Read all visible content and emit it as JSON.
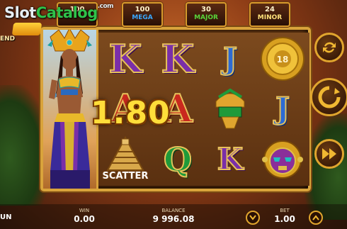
{
  "watermark": {
    "part1": "Slot",
    "part2": "Catalog",
    "part3": ".com"
  },
  "game_logo": {
    "text": "END"
  },
  "jackpots": [
    {
      "value": "100",
      "label": "",
      "color": "#ffd36a"
    },
    {
      "value": "100",
      "label": "MEGA",
      "color": "#3aa8ff"
    },
    {
      "value": "30",
      "label": "MAJOR",
      "color": "#5ad43a"
    },
    {
      "value": "24",
      "label": "MINOR",
      "color": "#ffe27a"
    }
  ],
  "reels": {
    "letters": [
      {
        "id": "k1",
        "text": "K",
        "color_class": "sym-purple"
      },
      {
        "id": "k2",
        "text": "K",
        "color_class": "sym-purple"
      },
      {
        "id": "j1",
        "text": "J",
        "color_class": "sym-blue"
      },
      {
        "id": "a1",
        "text": "A",
        "color_class": "sym-red"
      },
      {
        "id": "a2",
        "text": "A",
        "color_class": "sym-red"
      },
      {
        "id": "j2",
        "text": "J",
        "color_class": "sym-blue"
      },
      {
        "id": "q1",
        "text": "Q",
        "color_class": "sym-green"
      },
      {
        "id": "k3",
        "text": "K",
        "color_class": "sym-purple"
      }
    ],
    "coin_value": "18",
    "scatter_label": "SCATTER"
  },
  "win_display": "1.80",
  "footer": {
    "left_text": "UN",
    "win_label": "WIN",
    "win_value": "0.00",
    "balance_label": "BALANCE",
    "balance_value": "9 996.08",
    "bet_label": "BET",
    "bet_value": "1.00"
  },
  "icons": {
    "autoplay": "autoplay-icon",
    "spin": "spin-icon",
    "turbo": "fast-forward-icon",
    "bet_down": "chevron-down-icon",
    "bet_up": "chevron-up-icon"
  },
  "colors": {
    "frame_gold": "#d9a33b",
    "win_text": "#ffde3a"
  }
}
